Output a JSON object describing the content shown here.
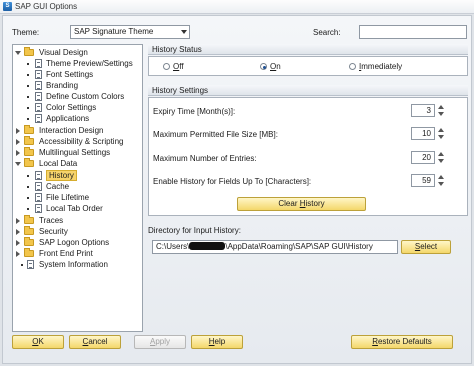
{
  "window": {
    "title": "SAP GUI Options",
    "icon": "sap-app-icon"
  },
  "theme": {
    "label": "Theme:",
    "value": "SAP Signature Theme"
  },
  "search": {
    "label": "Search:",
    "value": ""
  },
  "tree": {
    "visual_design": "Visual Design",
    "theme_preview": "Theme Preview/Settings",
    "font_settings": "Font Settings",
    "branding": "Branding",
    "define_custom_colors": "Define Custom Colors",
    "color_settings": "Color Settings",
    "applications": "Applications",
    "interaction_design": "Interaction Design",
    "accessibility": "Accessibility & Scripting",
    "multilingual": "Multilingual Settings",
    "local_data": "Local Data",
    "history": "History",
    "cache": "Cache",
    "file_lifetime": "File Lifetime",
    "local_tab_order": "Local Tab Order",
    "traces": "Traces",
    "security": "Security",
    "sap_logon_options": "SAP Logon Options",
    "front_end_print": "Front End Print",
    "system_information": "System Information"
  },
  "history_status": {
    "title": "History Status",
    "off": {
      "prefix": "",
      "hotkey": "O",
      "rest": "ff"
    },
    "on": {
      "prefix": "",
      "hotkey": "O",
      "rest": "n"
    },
    "immediately": {
      "prefix": "",
      "hotkey": "I",
      "rest": "mmediately"
    },
    "selected": "On"
  },
  "history_settings": {
    "title": "History Settings",
    "expiry": {
      "label": "Expiry Time [Month(s)]:",
      "value": "3"
    },
    "max_file_size": {
      "label": "Maximum Permitted File Size [MB]:",
      "value": "10"
    },
    "max_entries": {
      "label": "Maximum Number of Entries:",
      "value": "20"
    },
    "enable_fields": {
      "label": "Enable History for Fields Up To [Characters]:",
      "value": "59"
    },
    "clear": {
      "prefix": "Clear ",
      "hotkey": "H",
      "rest": "istory"
    }
  },
  "directory": {
    "label": "Directory for Input History:",
    "path_prefix": "C:\\Users\\",
    "path_suffix": "\\AppData\\Roaming\\SAP\\SAP GUI\\History",
    "select": {
      "prefix": "",
      "hotkey": "S",
      "rest": "elect"
    }
  },
  "footer": {
    "ok": {
      "hotkey": "O",
      "rest": "K"
    },
    "cancel": {
      "hotkey": "C",
      "rest": "ancel"
    },
    "apply": {
      "hotkey": "A",
      "rest": "pply"
    },
    "help": {
      "hotkey": "H",
      "rest": "elp"
    },
    "restore": {
      "hotkey": "R",
      "rest": "estore Defaults"
    }
  },
  "colors": {
    "selection": "#f7d36b",
    "button": "#f4d76a",
    "group_header": "#dfe4ea"
  }
}
